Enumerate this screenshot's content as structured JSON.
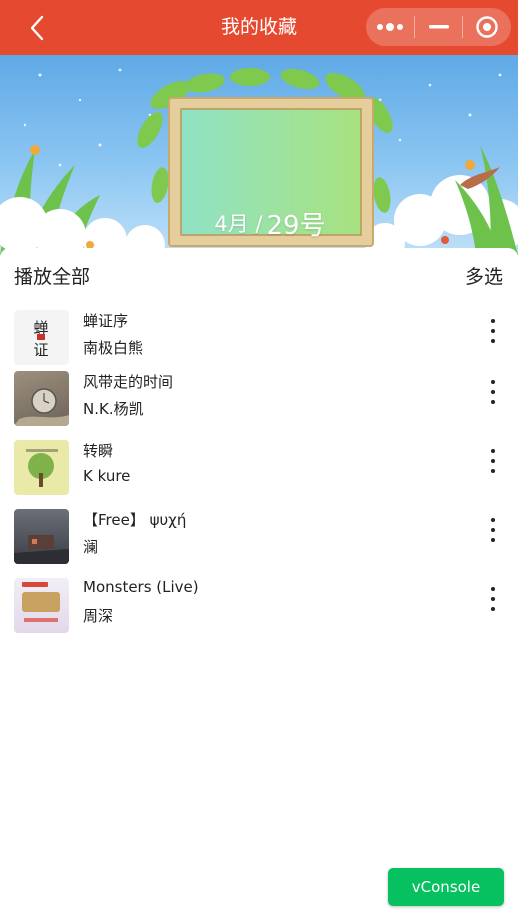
{
  "header": {
    "title": "我的收藏",
    "icons": {
      "back": "chevron-left-icon",
      "more": "more-dots-icon",
      "minimize": "minimize-icon",
      "close": "target-circle-icon"
    }
  },
  "banner": {
    "date_month": "4月 /",
    "date_day": "29号"
  },
  "toolbar": {
    "play_all": "播放全部",
    "multi_select": "多选"
  },
  "songs": [
    {
      "title": "蝉证序",
      "artist": "南极白熊",
      "cover_icon": "cover-calligraphy"
    },
    {
      "title": "风带走的时间",
      "artist": "N.K.杨凯",
      "cover_icon": "cover-pocket-watch"
    },
    {
      "title": "转瞬",
      "artist": "K kure",
      "cover_icon": "cover-tree"
    },
    {
      "title": "【Free】 ψυχή",
      "artist": "澜",
      "cover_icon": "cover-stormy-house"
    },
    {
      "title": "Monsters (Live)",
      "artist": "周深",
      "cover_icon": "cover-show-poster"
    }
  ],
  "vconsole": {
    "label": "vConsole"
  },
  "colors": {
    "header": "#e5492f",
    "vconsole": "#07c160"
  }
}
